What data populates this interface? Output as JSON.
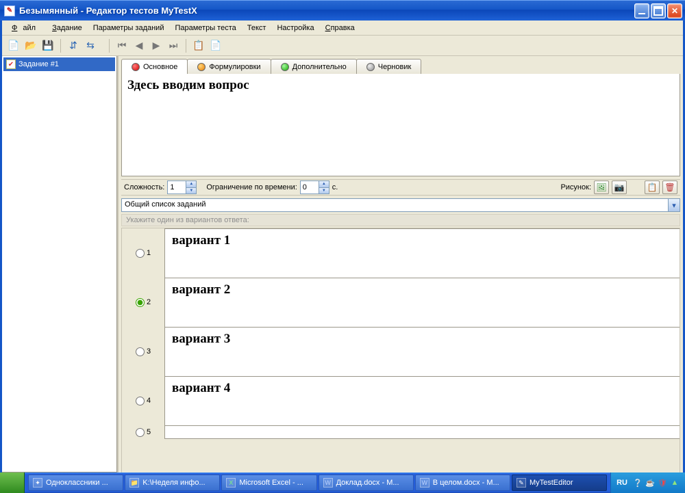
{
  "titlebar": {
    "text": "Безымянный - Редактор тестов MyTestX"
  },
  "menu": {
    "file": "Файл",
    "task": "Задание",
    "task_params": "Параметры заданий",
    "test_params": "Параметры теста",
    "text": "Текст",
    "settings": "Настройка",
    "help": "Справка"
  },
  "sidebar": {
    "task1": "Задание #1"
  },
  "tabs": {
    "main": "Основное",
    "phrasing": "Формулировки",
    "additional": "Дополнительно",
    "draft": "Черновик"
  },
  "question": "Здесь вводим вопрос",
  "meta": {
    "complexity_label": "Сложность:",
    "complexity_value": "1",
    "time_label": "Ограничение по времени:",
    "time_value": "0",
    "seconds_unit": "с.",
    "picture_label": "Рисунок:"
  },
  "dropdown": {
    "selected": "Общий список заданий"
  },
  "hint": "Укажите один из вариантов ответа:",
  "answers": {
    "a1": "вариант 1",
    "a2": "вариант 2",
    "a3": "вариант 3",
    "a4": "вариант 4",
    "a5": ""
  },
  "taskbar": {
    "t1": "Одноклассники ...",
    "t2": "K:\\Неделя инфо...",
    "t3": "Microsoft Excel - ...",
    "t4": "Доклад.docx - M...",
    "t5": "В целом.docx - M...",
    "t6": "MyTestEditor",
    "lang": "RU"
  }
}
